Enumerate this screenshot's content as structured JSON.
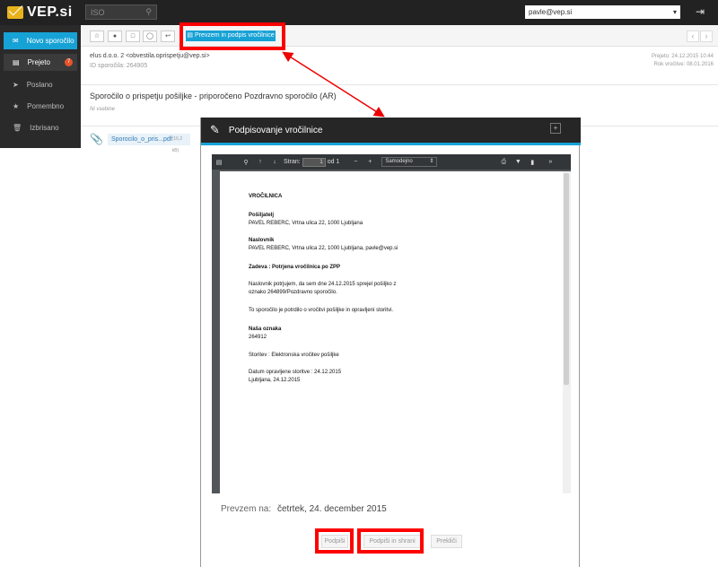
{
  "app": {
    "brand": "VEP.si"
  },
  "search": {
    "placeholder": "ISO"
  },
  "user": {
    "email": "pavle@vep.si"
  },
  "sidebar": {
    "items": [
      {
        "label": "Novo sporočilo",
        "icon": "envelope-icon"
      },
      {
        "label": "Prejeto",
        "icon": "inbox-icon",
        "badge": "7"
      },
      {
        "label": "Poslano",
        "icon": "send-icon"
      },
      {
        "label": "Pomembno",
        "icon": "star-icon"
      },
      {
        "label": "Izbrisano",
        "icon": "trash-icon"
      }
    ]
  },
  "toolbar": {
    "confirm_label": "Prevzem in podpis vročilnice"
  },
  "message": {
    "sender": "elus d.o.o. 2 <obvestila.oprispetju@vep.si>",
    "id": "ID sporočila: 264905",
    "received": "Prejeto: 24.12.2015 10:44",
    "deadline": "Rok vročitve: 08.01.2016",
    "subject": "Sporočilo o prispetju pošiljke - priporočeno Pozdravno sporočilo (AR)",
    "no_content": "Ni vsebine",
    "attachment": {
      "name": "Sporocilo_o_pris...pdf",
      "size": "(16,2 kB)"
    }
  },
  "modal": {
    "title": "Podpisovanje vročilnice",
    "viewer": {
      "page_label": "Stran:",
      "page_value": "1",
      "page_total": "od 1",
      "zoom": "Samodejno"
    },
    "doc": {
      "heading": "VROČILNICA",
      "sender_label": "Pošiljatelj",
      "sender_value": "PAVEL REBERC, Vrtna ulica 22, 1000 Ljubljana",
      "recipient_label": "Naslovnik",
      "recipient_value": "PAVEL REBERC, Vrtna ulica 22, 1000 Ljubljana, pavle@vep.si",
      "subject": "Zadeva : Potrjena vročilnica po ZPP",
      "para1_l1": "Naslovnik potrjujem, da sem dne 24.12.2015 sprejel pošiljko z",
      "para1_l2": "oznako 264899/Pozdravno sporočilo.",
      "para2": "To sporočilo je potrdilo o vročitvi pošiljke in opravljeni storitvi.",
      "ref_label": "Naša oznaka",
      "ref_value": "264912",
      "service": "Storitev : Elektronska vročitev pošiljke",
      "date_done": "Datum opravljene storitve : 24.12.2015",
      "place_date": "Ljubljana, 24.12.2015"
    },
    "received_label": "Prevzem na:",
    "received_value": "četrtek, 24. december 2015",
    "buttons": {
      "sign": "Podpiši",
      "sign_save": "Podpiši in shrani",
      "cancel": "Prekliči"
    }
  }
}
